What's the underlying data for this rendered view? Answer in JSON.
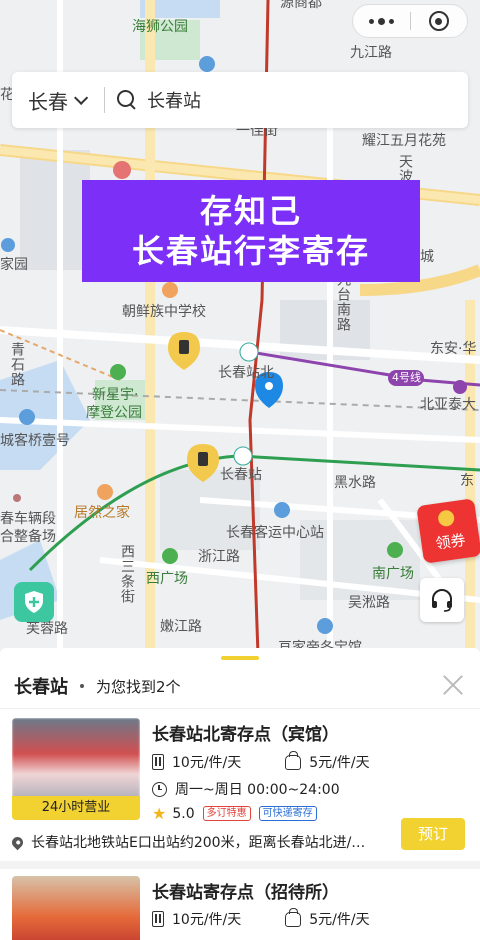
{
  "capsule": {
    "more_icon": "more-dots-icon",
    "close_icon": "target-circle-icon"
  },
  "search": {
    "city": "长春",
    "keyword": "长春站"
  },
  "banner": {
    "line1": "存知己",
    "line2": "长春站行李寄存"
  },
  "map": {
    "labels": {
      "haishi": "海狮公园",
      "yuanshangdu": "源商都",
      "jiujiang": "九江路",
      "hua": "花",
      "yijie": "一佳街",
      "yaojiang": "耀江五月花苑",
      "tianbo": "天波",
      "jiayuan": "家园",
      "cheng": "城",
      "chaoxian": "朝鲜族中学校",
      "jiutai": "九台南路",
      "qingshi": "青石路",
      "changchunzhanbei": "长春站北",
      "dongan": "东安·华",
      "line4": "4号线",
      "xinxingyu": "新星宇·",
      "modeng": "摩登公园",
      "beiyatai": "北亚泰大",
      "chengqiao": "城客桥壹号",
      "changchunzhan": "长春站",
      "heishui": "黑水路",
      "dong": "东",
      "chechang": "春车辆段",
      "heting": "合整备场",
      "juran": "居然之家",
      "keyun": "长春客运中心站",
      "xisantiao": "西三条街",
      "zhejiang": "浙江路",
      "xiguangchang": "西广场",
      "nanguangchang": "南广场",
      "wusong": "吴淞路",
      "furong": "芙蓉路",
      "nenjiang": "嫩江路",
      "bottom": "亘家帝冬宝馆"
    },
    "colors": {
      "road_red": "#c0392b",
      "metro_purple": "#8e44ad",
      "metro_green": "#2e9e50",
      "pin_blue": "#1e88e5",
      "locker_yellow": "#f2c94c"
    },
    "coupon_label": "领券"
  },
  "sheet": {
    "title": "长春站",
    "count_text": "为您找到2个",
    "cards": [
      {
        "name": "长春站北寄存点（宾馆）",
        "price_luggage": "10元/件/天",
        "price_bag": "5元/件/天",
        "hours": "周一~周日 00:00~24:00",
        "rating": "5.0",
        "tag1": "多订特惠",
        "tag2": "可快递寄存",
        "badge": "24小时营业",
        "address": "长春站北地铁站E口出站约200米，距离长春站北进/…",
        "book": "预订"
      },
      {
        "name": "长春站寄存点（招待所）",
        "price_luggage": "10元/件/天",
        "price_bag": "5元/件/天"
      }
    ]
  }
}
